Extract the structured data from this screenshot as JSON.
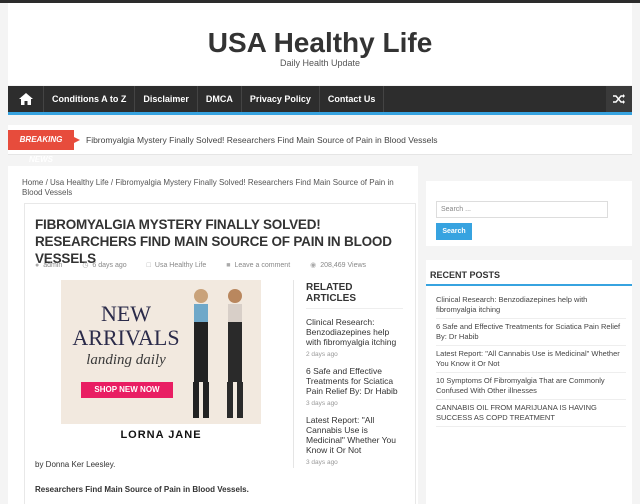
{
  "site": {
    "title": "USA Healthy Life",
    "tagline": "Daily Health Update"
  },
  "nav": {
    "items": [
      "Conditions A to Z",
      "Disclaimer",
      "DMCA",
      "Privacy Policy",
      "Contact Us"
    ],
    "home_icon": "home-icon",
    "random_icon": "shuffle-icon"
  },
  "breaking": {
    "label": "Breaking News",
    "headline": "Fibromyalgia Mystery Finally Solved! Researchers Find Main Source of Pain in Blood Vessels"
  },
  "breadcrumb": "Home  /  Usa Healthy Life  /  Fibromyalgia Mystery Finally Solved! Researchers Find Main Source of Pain in Blood Vessels",
  "article": {
    "title": "Fibromyalgia Mystery Finally Solved! Researchers Find Main Source of Pain in Blood Vessels",
    "author": "admin",
    "date": "6 days ago",
    "category": "Usa Healthy Life",
    "comments": "Leave a comment",
    "views": "208,469 Views",
    "byline": "by Donna Ker Leesley.",
    "lead": "Researchers Find Main Source of Pain in Blood Vessels."
  },
  "ad": {
    "line1": "NEW",
    "line2": "ARRIVALS",
    "line3": "landing daily",
    "cta": "SHOP NEW NOW",
    "brand": "LORNA JANE"
  },
  "related": {
    "heading": "Related Articles",
    "items": [
      {
        "title": "Clinical Research: Benzodiazepines help with fibromyalgia itching",
        "date": "2 days ago"
      },
      {
        "title": "6 Safe and Effective Treatments for Sciatica Pain Relief By: Dr Habib",
        "date": "3 days ago"
      },
      {
        "title": "Latest Report: \"All Cannabis Use is Medicinal\" Whether You Know it Or Not",
        "date": "3 days ago"
      }
    ]
  },
  "sidebar": {
    "search_placeholder": "Search ...",
    "search_button": "Search",
    "recent_heading": "Recent Posts",
    "recent": [
      "Clinical Research: Benzodiazepines help with fibromyalgia itching",
      "6 Safe and Effective Treatments for Sciatica Pain Relief By: Dr Habib",
      "Latest Report: \"All Cannabis Use is Medicinal\" Whether You Know it Or Not",
      "10 Symptoms Of Fibromyalgia That are Commonly Confused With Other illnesses",
      "CANNABIS OIL FROM MARIJUANA IS HAVING SUCCESS AS COPD TREATMENT"
    ]
  },
  "colors": {
    "accent": "#37a3e0",
    "breaking": "#e74c3c",
    "nav": "#2d2d2d"
  }
}
